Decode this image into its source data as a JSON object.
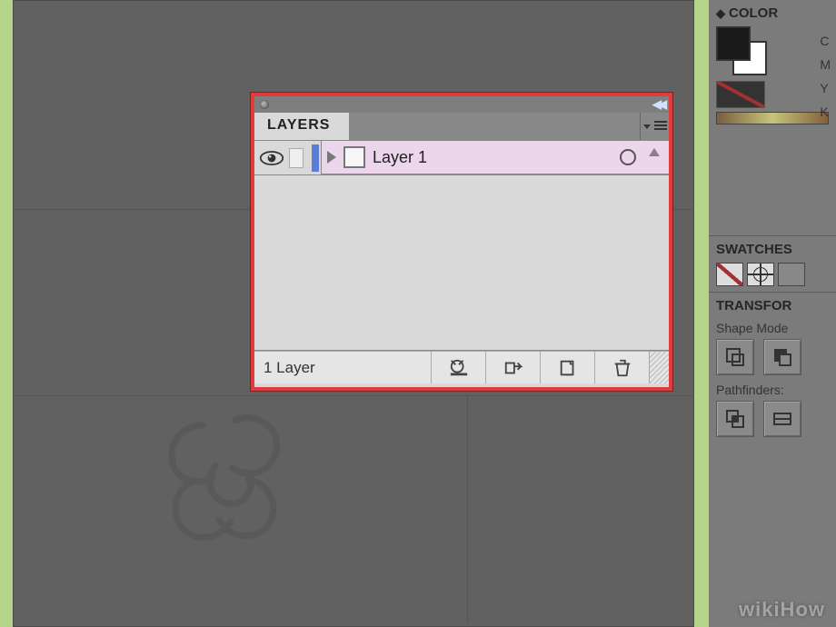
{
  "layers_panel": {
    "tab_label": "LAYERS",
    "layers": [
      {
        "name": "Layer 1",
        "visible": true
      }
    ],
    "footer_count": "1 Layer"
  },
  "right_panels": {
    "color": {
      "title": "COLOR",
      "channels": [
        "C",
        "M",
        "Y",
        "K"
      ]
    },
    "swatches": {
      "title": "SWATCHES"
    },
    "transform": {
      "title": "TRANSFOR",
      "shape_modes_label": "Shape Mode",
      "pathfinders_label": "Pathfinders:"
    }
  },
  "watermark": "wikiHow"
}
